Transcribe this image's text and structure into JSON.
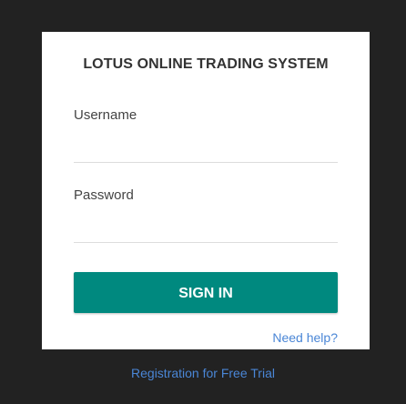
{
  "login": {
    "title": "LOTUS ONLINE TRADING SYSTEM",
    "username_label": "Username",
    "username_value": "",
    "password_label": "Password",
    "password_value": "",
    "signin_label": "SIGN IN",
    "help_link": "Need help?"
  },
  "footer": {
    "register_link": "Registration for Free Trial"
  },
  "colors": {
    "background": "#222222",
    "card": "#ffffff",
    "primary_button": "#00897f",
    "link": "#4a86d6"
  }
}
